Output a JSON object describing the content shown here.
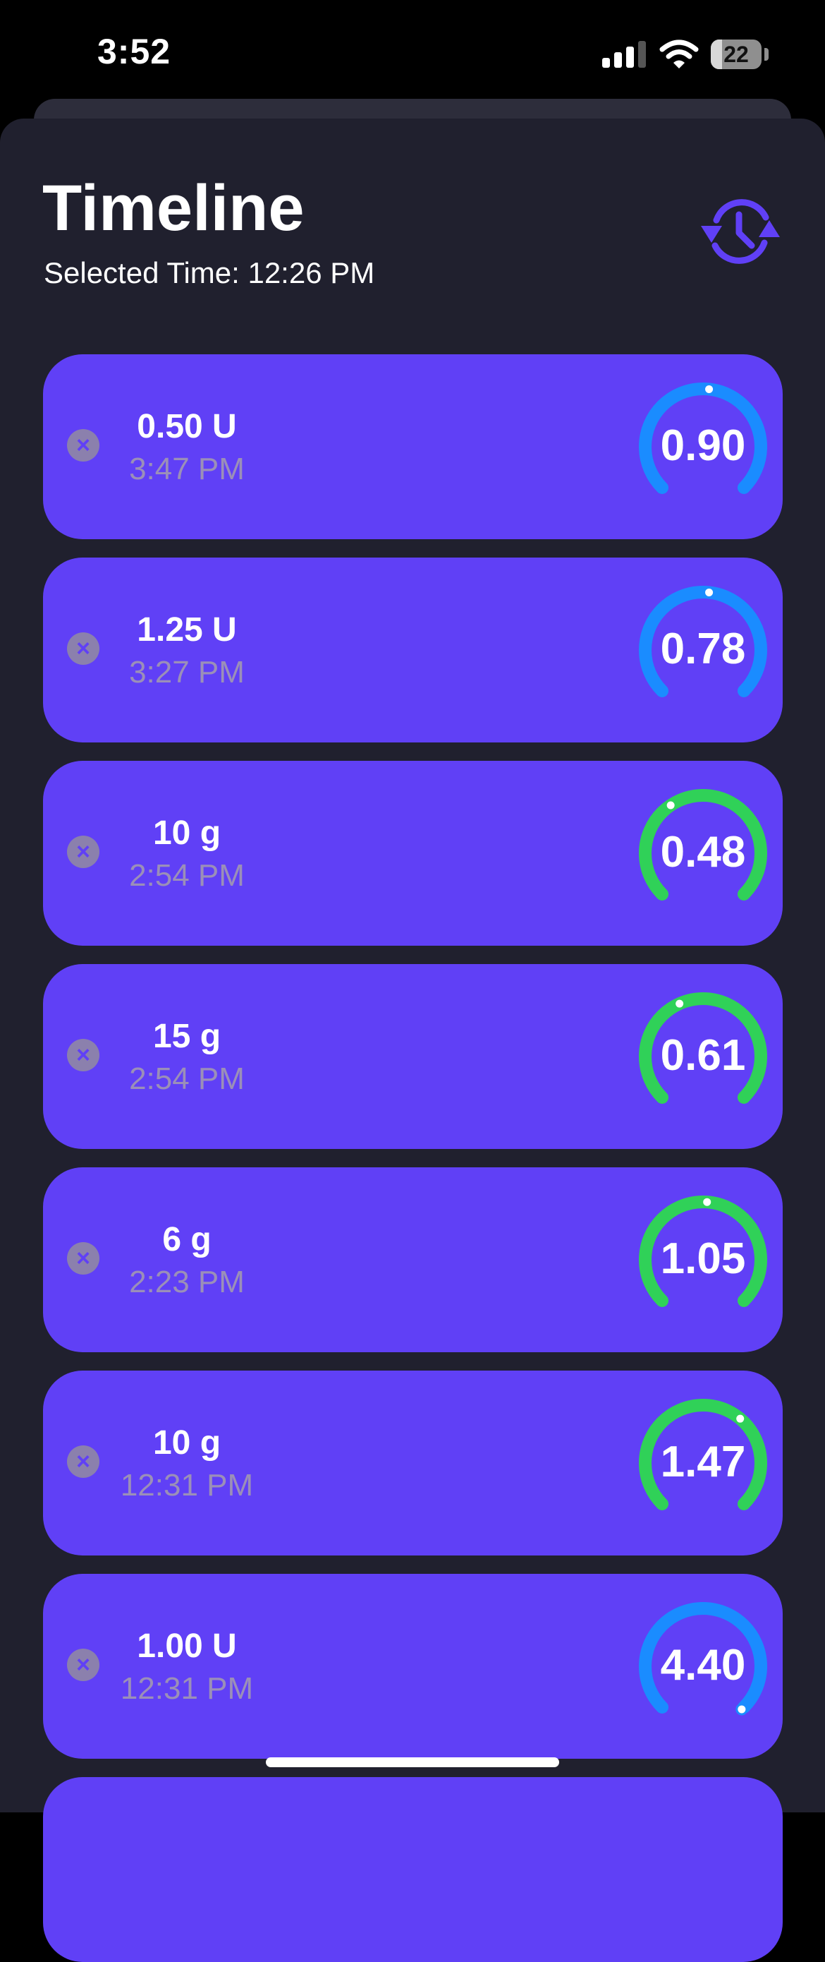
{
  "status_bar": {
    "time": "3:52",
    "battery": "22",
    "battery_level": 0.22,
    "signal_bars_active": 3,
    "signal_bars_total": 4
  },
  "header": {
    "title": "Timeline",
    "subtitle": "Selected Time: 12:26 PM",
    "history_icon": "clock-rotate-icon"
  },
  "colors": {
    "background": "#20202e",
    "card": "#6040f6",
    "insulin_ring": "#1a8cff",
    "carb_ring": "#30d158",
    "secondary_text": "#9b8fb8"
  },
  "entries": [
    {
      "amount": "0.50 U",
      "time": "3:47 PM",
      "value": "0.90",
      "kind": "insulin",
      "ring_color": "#1a8cff"
    },
    {
      "amount": "1.25 U",
      "time": "3:27 PM",
      "value": "0.78",
      "kind": "insulin",
      "ring_color": "#1a8cff"
    },
    {
      "amount": "10 g",
      "time": "2:54 PM",
      "value": "0.48",
      "kind": "carbs",
      "ring_color": "#30d158"
    },
    {
      "amount": "15 g",
      "time": "2:54 PM",
      "value": "0.61",
      "kind": "carbs",
      "ring_color": "#30d158"
    },
    {
      "amount": "6 g",
      "time": "2:23 PM",
      "value": "1.05",
      "kind": "carbs",
      "ring_color": "#30d158"
    },
    {
      "amount": "10 g",
      "time": "12:31 PM",
      "value": "1.47",
      "kind": "carbs",
      "ring_color": "#30d158"
    },
    {
      "amount": "1.00 U",
      "time": "12:31 PM",
      "value": "4.40",
      "kind": "insulin",
      "ring_color": "#1a8cff"
    }
  ]
}
